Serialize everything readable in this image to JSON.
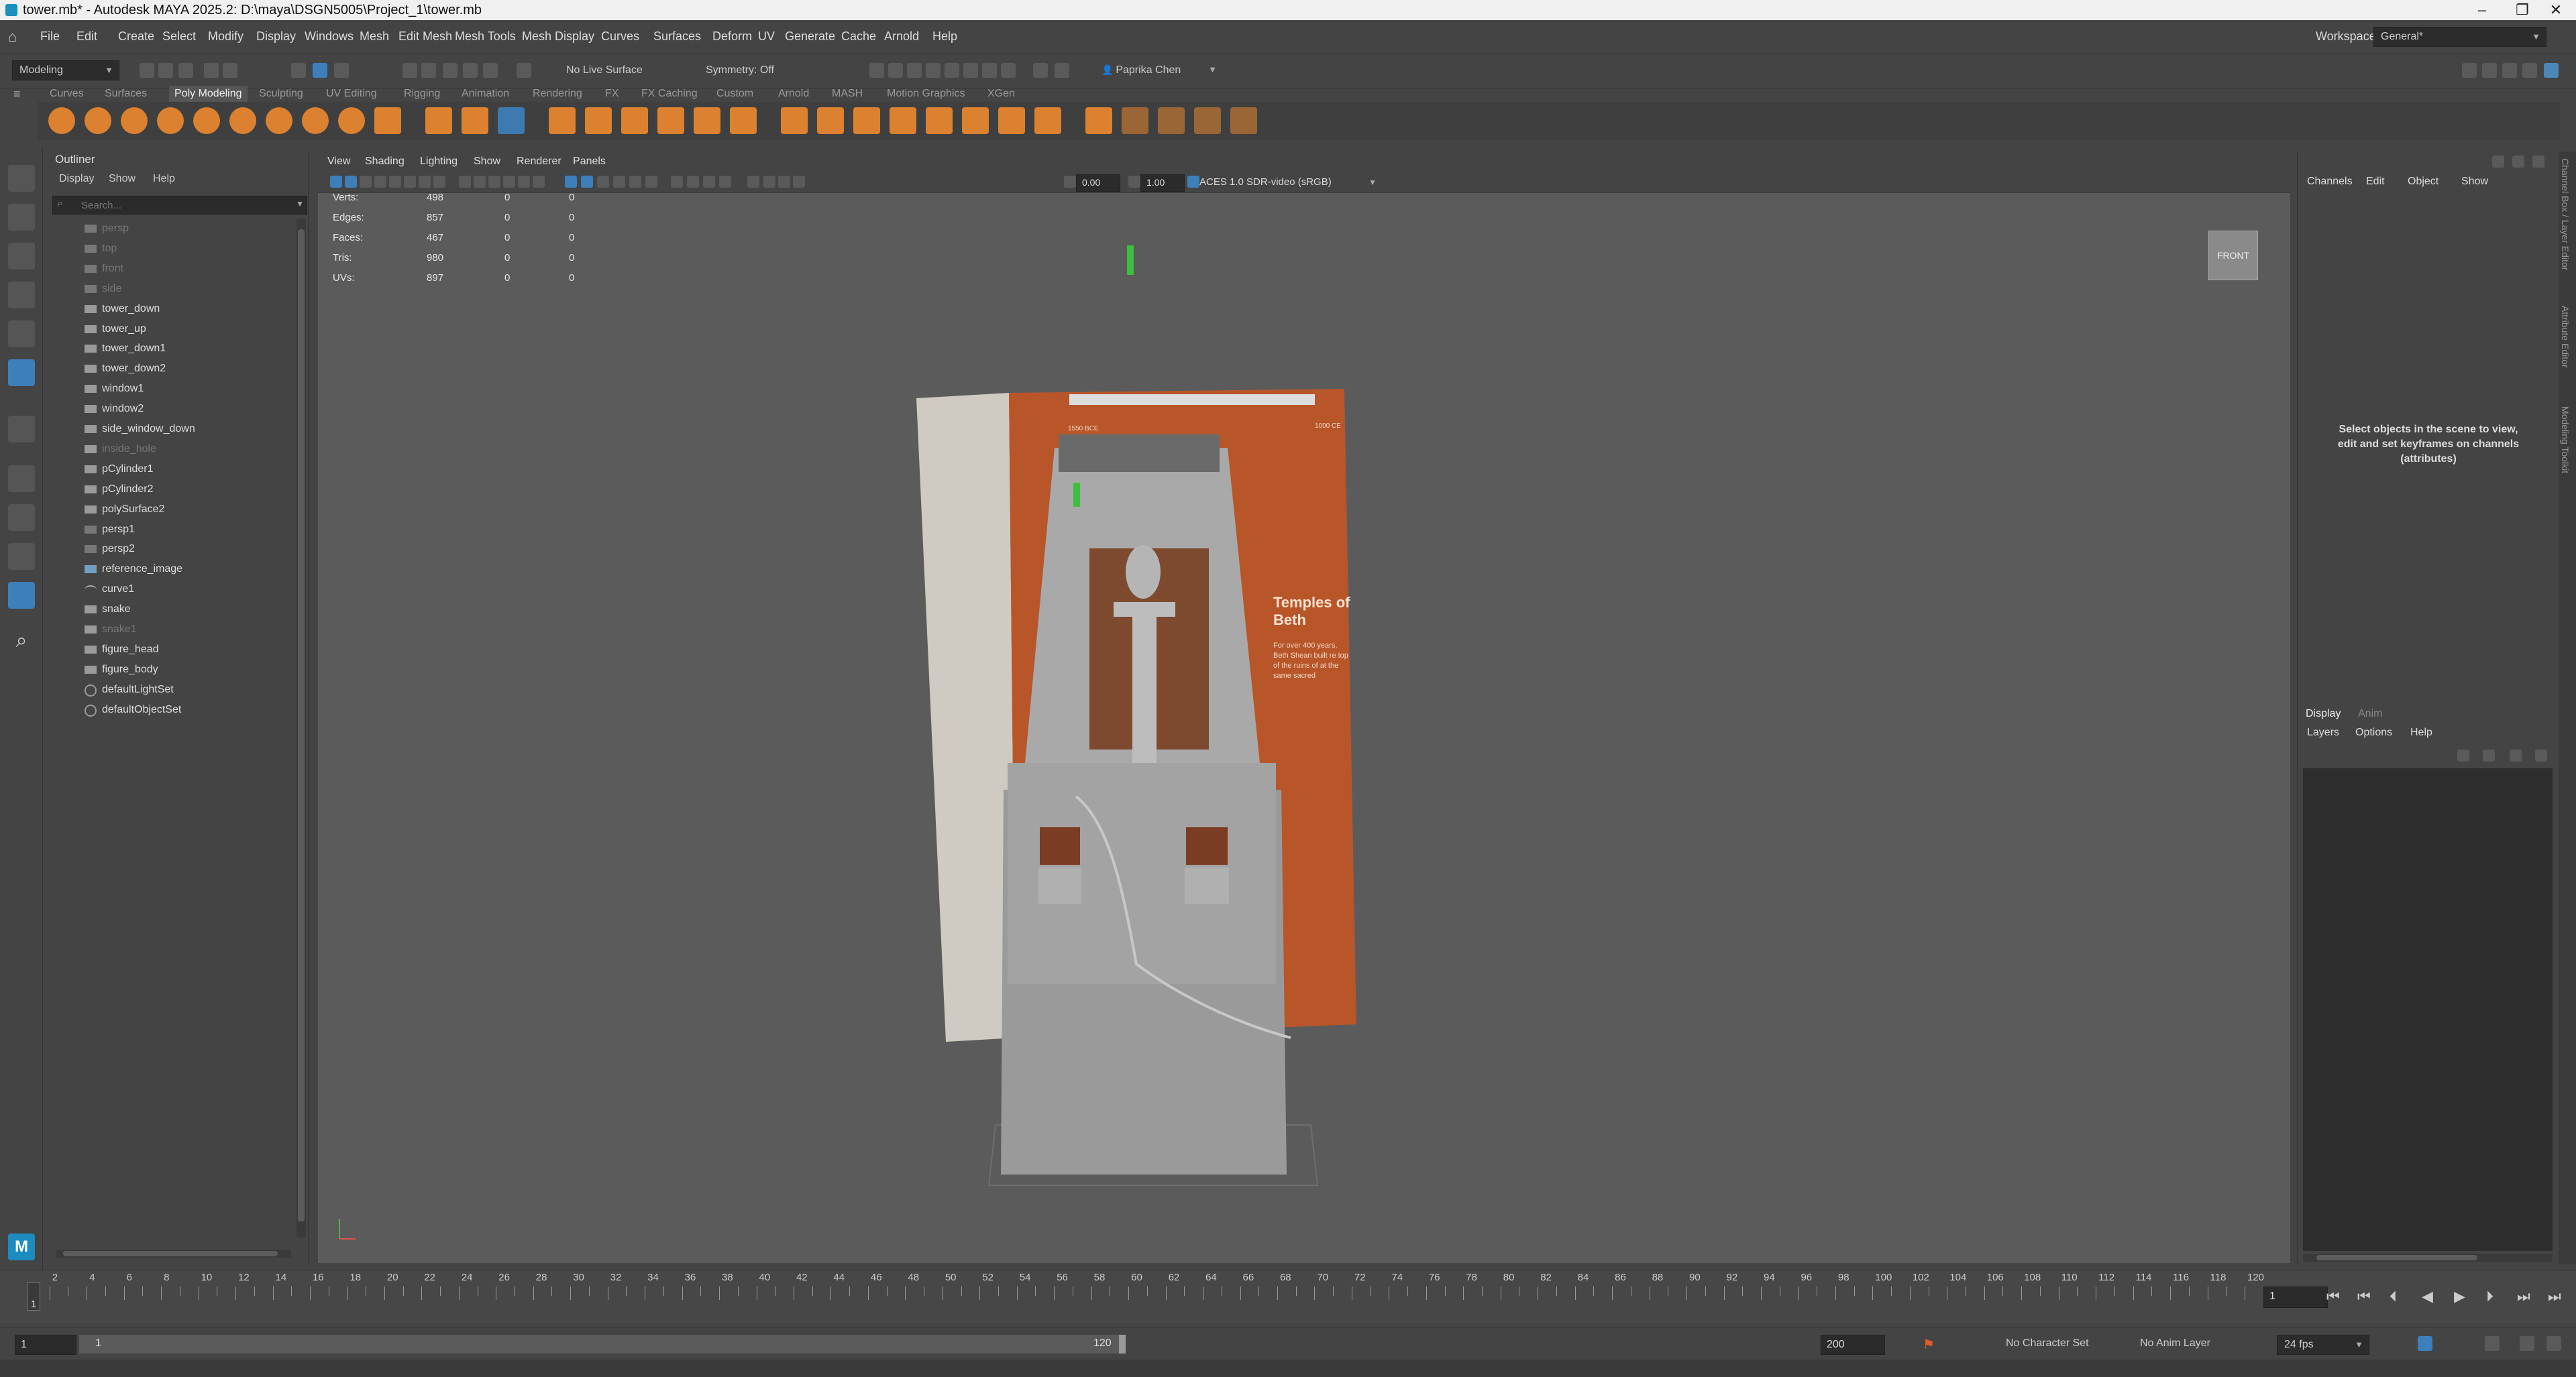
{
  "window": {
    "title": "tower.mb* - Autodesk MAYA 2025.2: D:\\maya\\DSGN5005\\Project_1\\tower.mb",
    "minimize": "–",
    "maximize": "❐",
    "close": "✕"
  },
  "menubar": {
    "items": [
      "File",
      "Edit",
      "Create",
      "Select",
      "Modify",
      "Display",
      "Windows",
      "Mesh",
      "Edit Mesh",
      "Mesh Tools",
      "Mesh Display",
      "Curves",
      "Surfaces",
      "Deform",
      "UV",
      "Generate",
      "Cache",
      "Arnold",
      "Help"
    ],
    "workspace_label": "Workspace:",
    "workspace_value": "General*"
  },
  "statusline": {
    "mode": "Modeling",
    "live_surface": "No Live Surface",
    "symmetry": "Symmetry: Off",
    "user": "Paprika Chen"
  },
  "shelf": {
    "tabs": [
      "Curves",
      "Surfaces",
      "Poly Modeling",
      "Sculpting",
      "UV Editing",
      "Rigging",
      "Animation",
      "Rendering",
      "FX",
      "FX Caching",
      "Custom",
      "Arnold",
      "MASH",
      "Motion Graphics",
      "XGen"
    ],
    "active_tab": "Poly Modeling",
    "accent_color": "#e8872f"
  },
  "outliner": {
    "title": "Outliner",
    "menu": [
      "Display",
      "Show",
      "Help"
    ],
    "search_placeholder": "Search...",
    "items": [
      {
        "label": "persp",
        "dim": true,
        "icon": "camera-icon"
      },
      {
        "label": "top",
        "dim": true,
        "icon": "camera-icon"
      },
      {
        "label": "front",
        "dim": true,
        "icon": "camera-icon"
      },
      {
        "label": "side",
        "dim": true,
        "icon": "camera-icon"
      },
      {
        "label": "tower_down",
        "dim": false,
        "icon": "mesh-icon"
      },
      {
        "label": "tower_up",
        "dim": false,
        "icon": "mesh-icon"
      },
      {
        "label": "tower_down1",
        "dim": false,
        "icon": "mesh-icon"
      },
      {
        "label": "tower_down2",
        "dim": false,
        "icon": "mesh-icon"
      },
      {
        "label": "window1",
        "dim": false,
        "icon": "mesh-icon"
      },
      {
        "label": "window2",
        "dim": false,
        "icon": "mesh-icon"
      },
      {
        "label": "side_window_down",
        "dim": false,
        "icon": "mesh-icon"
      },
      {
        "label": "inside_hole",
        "dim": true,
        "icon": "mesh-icon"
      },
      {
        "label": "pCylinder1",
        "dim": false,
        "icon": "mesh-icon"
      },
      {
        "label": "pCylinder2",
        "dim": false,
        "icon": "mesh-icon"
      },
      {
        "label": "polySurface2",
        "dim": false,
        "icon": "mesh-icon"
      },
      {
        "label": "persp1",
        "dim": false,
        "icon": "camera-icon"
      },
      {
        "label": "persp2",
        "dim": false,
        "icon": "camera-icon"
      },
      {
        "label": "reference_image",
        "dim": false,
        "icon": "image-plane-icon"
      },
      {
        "label": "curve1",
        "dim": false,
        "icon": "curve-icon"
      },
      {
        "label": "snake",
        "dim": false,
        "icon": "mesh-icon"
      },
      {
        "label": "snake1",
        "dim": true,
        "icon": "mesh-icon"
      },
      {
        "label": "figure_head",
        "dim": false,
        "icon": "mesh-icon"
      },
      {
        "label": "figure_body",
        "dim": false,
        "icon": "mesh-icon"
      },
      {
        "label": "defaultLightSet",
        "dim": false,
        "icon": "set-icon"
      },
      {
        "label": "defaultObjectSet",
        "dim": false,
        "icon": "set-icon"
      }
    ]
  },
  "viewport": {
    "menu": [
      "View",
      "Shading",
      "Lighting",
      "Show",
      "Renderer",
      "Panels"
    ],
    "exposure": "0.00",
    "gamma": "1.00",
    "color_space": "ACES 1.0 SDR-video (sRGB)",
    "hud": [
      {
        "label": "Verts:",
        "values": [
          "498",
          "0",
          "0"
        ]
      },
      {
        "label": "Edges:",
        "values": [
          "857",
          "0",
          "0"
        ]
      },
      {
        "label": "Faces:",
        "values": [
          "467",
          "0",
          "0"
        ]
      },
      {
        "label": "Tris:",
        "values": [
          "980",
          "0",
          "0"
        ]
      },
      {
        "label": "UVs:",
        "values": [
          "897",
          "0",
          "0"
        ]
      }
    ],
    "view_cube": "FRONT",
    "poster_title": "Temples of Beth Shean",
    "poster_body": "For over 400 years, Beth Shean built re top of the ruins of at the same sacred",
    "poster_tag_left": "1550 BCE",
    "poster_tag_right": "1000 CE"
  },
  "channelbox": {
    "menu": [
      "Channels",
      "Edit",
      "Object",
      "Show"
    ],
    "empty_message": "Select objects in the scene to view, edit and set keyframes on channels (attributes)",
    "side_tabs": [
      "Channel Box / Layer Editor",
      "Attribute Editor",
      "Modeling Toolkit"
    ]
  },
  "layers": {
    "tabs": [
      "Display",
      "Anim"
    ],
    "menu": [
      "Layers",
      "Options",
      "Help"
    ]
  },
  "timeline": {
    "ticks": [
      "2",
      "4",
      "6",
      "8",
      "10",
      "12",
      "14",
      "16",
      "18",
      "20",
      "22",
      "24",
      "26",
      "28",
      "30",
      "32",
      "34",
      "36",
      "38",
      "40",
      "42",
      "44",
      "46",
      "48",
      "50",
      "52",
      "54",
      "56",
      "58",
      "60",
      "62",
      "64",
      "66",
      "68",
      "70",
      "72",
      "74",
      "76",
      "78",
      "80",
      "82",
      "84",
      "86",
      "88",
      "90",
      "92",
      "94",
      "96",
      "98",
      "100",
      "102",
      "104",
      "106",
      "108",
      "110",
      "112",
      "114",
      "116",
      "118",
      "120"
    ],
    "first_tick": "1",
    "current_frame": "1"
  },
  "range": {
    "start": "1",
    "inner_start": "1",
    "inner_end": "120",
    "end": "200",
    "character_set": "No Character Set",
    "anim_layer": "No Anim Layer",
    "fps": "24 fps"
  }
}
